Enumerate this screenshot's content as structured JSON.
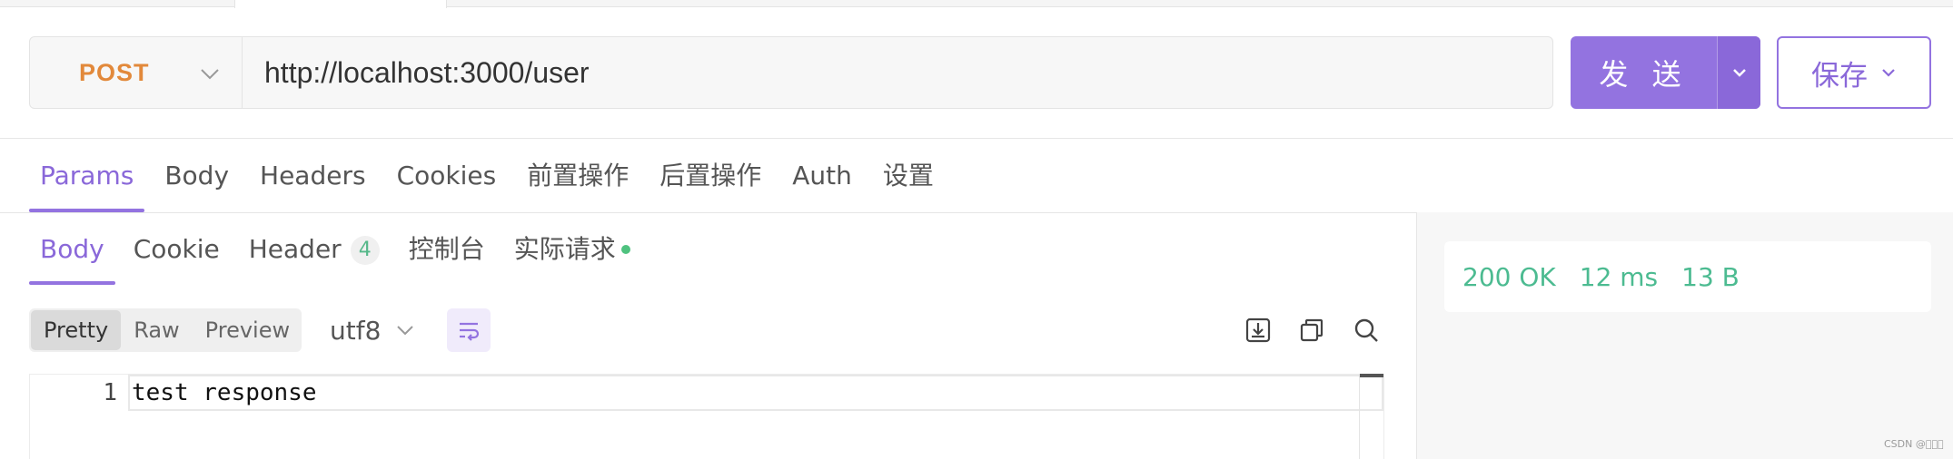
{
  "request": {
    "method": "POST",
    "url": "http://localhost:3000/user",
    "send_label": "发 送",
    "save_label": "保存"
  },
  "request_tabs": [
    {
      "label": "Params",
      "active": true
    },
    {
      "label": "Body"
    },
    {
      "label": "Headers"
    },
    {
      "label": "Cookies"
    },
    {
      "label": "前置操作"
    },
    {
      "label": "后置操作"
    },
    {
      "label": "Auth"
    },
    {
      "label": "设置"
    }
  ],
  "response_tabs": {
    "body": "Body",
    "cookie": "Cookie",
    "header": "Header",
    "header_count": "4",
    "console": "控制台",
    "actual_request": "实际请求"
  },
  "view_modes": {
    "pretty": "Pretty",
    "raw": "Raw",
    "preview": "Preview"
  },
  "encoding": "utf8",
  "editor": {
    "line_number": "1",
    "line_text": "test response"
  },
  "status": {
    "code": "200 OK",
    "time": "12 ms",
    "size": "13 B"
  },
  "colors": {
    "accent": "#9373e0",
    "method_post": "#e2893b",
    "status_ok": "#4cbb91"
  },
  "icons": [
    "chevron-down-icon",
    "download-icon",
    "copy-icon",
    "search-icon",
    "wrap-lines-icon"
  ],
  "watermark": "CSDN @\u0000\u0000\u0000"
}
